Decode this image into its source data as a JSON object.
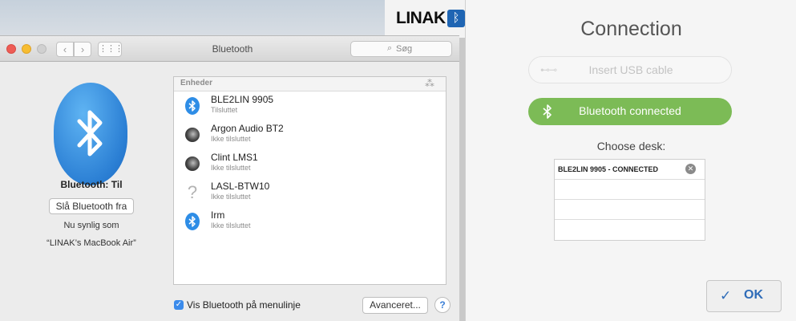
{
  "colors": {
    "bluetooth_blue": "#2b7fd4",
    "connected_green": "#7cbb56",
    "linak_blue": "#1f65b3",
    "ok_blue": "#2f6cb8"
  },
  "background": {
    "brand_logo": "LINAK",
    "brand_badge_icon": "linak-bluetooth-icon"
  },
  "bt_window": {
    "title": "Bluetooth",
    "search_placeholder": "Søg",
    "icons": {
      "back": "chevron-left-icon",
      "forward": "chevron-right-icon",
      "show_all": "grid-icon",
      "search": "search-icon",
      "bluetooth": "bluetooth-icon"
    },
    "status": "Bluetooth: Til",
    "toggle_label": "Slå Bluetooth fra",
    "visible_as": "Nu synlig som",
    "computer_name": "“LINAK’s MacBook Air”",
    "devices_header": "Enheder",
    "devices": [
      {
        "name": "BLE2LIN 9905",
        "state": "Tilsluttet",
        "icon": "bluetooth-icon"
      },
      {
        "name": "Argon Audio BT2",
        "state": "Ikke tilsluttet",
        "icon": "speaker-icon"
      },
      {
        "name": "Clint LMS1",
        "state": "Ikke tilsluttet",
        "icon": "speaker-icon"
      },
      {
        "name": "LASL-BTW10",
        "state": "Ikke tilsluttet",
        "icon": "unknown-device-icon"
      },
      {
        "name": "Irm",
        "state": "Ikke tilsluttet",
        "icon": "bluetooth-icon"
      }
    ],
    "show_in_menu_checked": true,
    "show_in_menu_label": "Vis Bluetooth på menulinje",
    "advanced_label": "Avanceret...",
    "help_label": "?"
  },
  "connection": {
    "title": "Connection",
    "usb_label": "Insert USB cable",
    "usb_icon": "usb-icon",
    "bt_label": "Bluetooth connected",
    "bt_icon": "bluetooth-icon",
    "choose_label": "Choose desk:",
    "desks": [
      "BLE2LIN 9905 - CONNECTED",
      "",
      "",
      ""
    ],
    "clear_icon": "close-circle-icon",
    "ok_label": "OK",
    "ok_icon": "checkmark-icon"
  }
}
